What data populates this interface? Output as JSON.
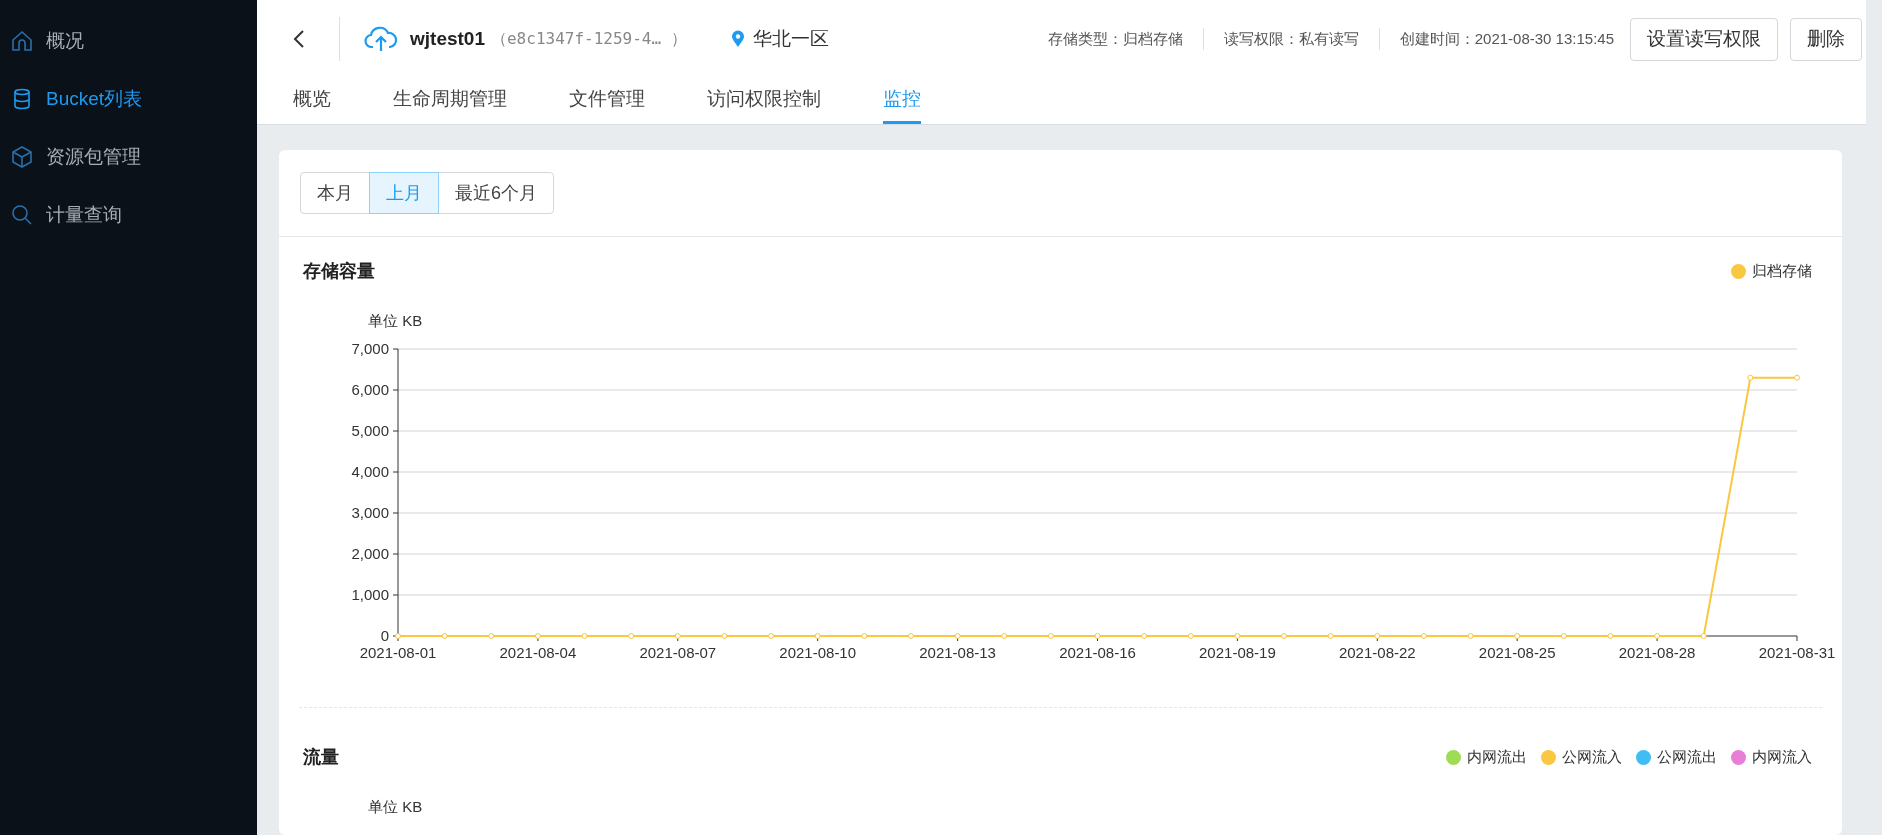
{
  "sidebar": {
    "items": [
      {
        "label": "概况",
        "selected": false
      },
      {
        "label": "Bucket列表",
        "selected": true
      },
      {
        "label": "资源包管理",
        "selected": false
      },
      {
        "label": "计量查询",
        "selected": false
      }
    ]
  },
  "header": {
    "bucket_name": "wjtest01",
    "bucket_id": "（e8c1347f-1259-4… ）",
    "region": "华北一区",
    "meta": [
      "存储类型：归档存储",
      "读写权限：私有读写",
      "创建时间：2021-08-30 13:15:45"
    ],
    "buttons": [
      "设置读写权限",
      "删除"
    ]
  },
  "tabs": [
    {
      "label": "概览",
      "selected": false
    },
    {
      "label": "生命周期管理",
      "selected": false
    },
    {
      "label": "文件管理",
      "selected": false
    },
    {
      "label": "访问权限控制",
      "selected": false
    },
    {
      "label": "监控",
      "selected": true
    }
  ],
  "range_buttons": [
    {
      "label": "本月",
      "selected": false
    },
    {
      "label": "上月",
      "selected": true
    },
    {
      "label": "最近6个月",
      "selected": false
    }
  ],
  "storage_chart": {
    "chart_data": {
      "type": "line",
      "title": "存储容量",
      "ylabel": "单位 KB",
      "categories": [
        "2021-08-01",
        null,
        null,
        "2021-08-04",
        null,
        null,
        "2021-08-07",
        null,
        null,
        "2021-08-10",
        null,
        null,
        "2021-08-13",
        null,
        null,
        "2021-08-16",
        null,
        null,
        "2021-08-19",
        null,
        null,
        "2021-08-22",
        null,
        null,
        "2021-08-25",
        null,
        null,
        "2021-08-28",
        null,
        null,
        "2021-08-31"
      ],
      "grid": true,
      "series": [
        {
          "name": "归档存储",
          "color": "#f9c740",
          "marker": "circle",
          "values": [
            0,
            0,
            0,
            0,
            0,
            0,
            0,
            0,
            0,
            0,
            0,
            0,
            0,
            0,
            0,
            0,
            0,
            0,
            0,
            0,
            0,
            0,
            0,
            0,
            0,
            0,
            0,
            0,
            0,
            6300,
            6300
          ]
        }
      ],
      "ylim": [
        0,
        7000
      ],
      "yticks": [
        {
          "value": 0,
          "label": "0"
        },
        {
          "value": 1000,
          "label": "1,000"
        },
        {
          "value": 2000,
          "label": "2,000"
        },
        {
          "value": 3000,
          "label": "3,000"
        },
        {
          "value": 4000,
          "label": "4,000"
        },
        {
          "value": 5000,
          "label": "5,000"
        },
        {
          "value": 6000,
          "label": "6,000"
        },
        {
          "value": 7000,
          "label": "7,000"
        }
      ]
    }
  },
  "traffic_chart": {
    "title": "流量",
    "unit": "单位 KB",
    "legend": [
      {
        "label": "内网流出",
        "color": "#9fdc55"
      },
      {
        "label": "公网流入",
        "color": "#f9c740"
      },
      {
        "label": "公网流出",
        "color": "#40bdf2"
      },
      {
        "label": "内网流入",
        "color": "#e87ed8"
      }
    ]
  }
}
